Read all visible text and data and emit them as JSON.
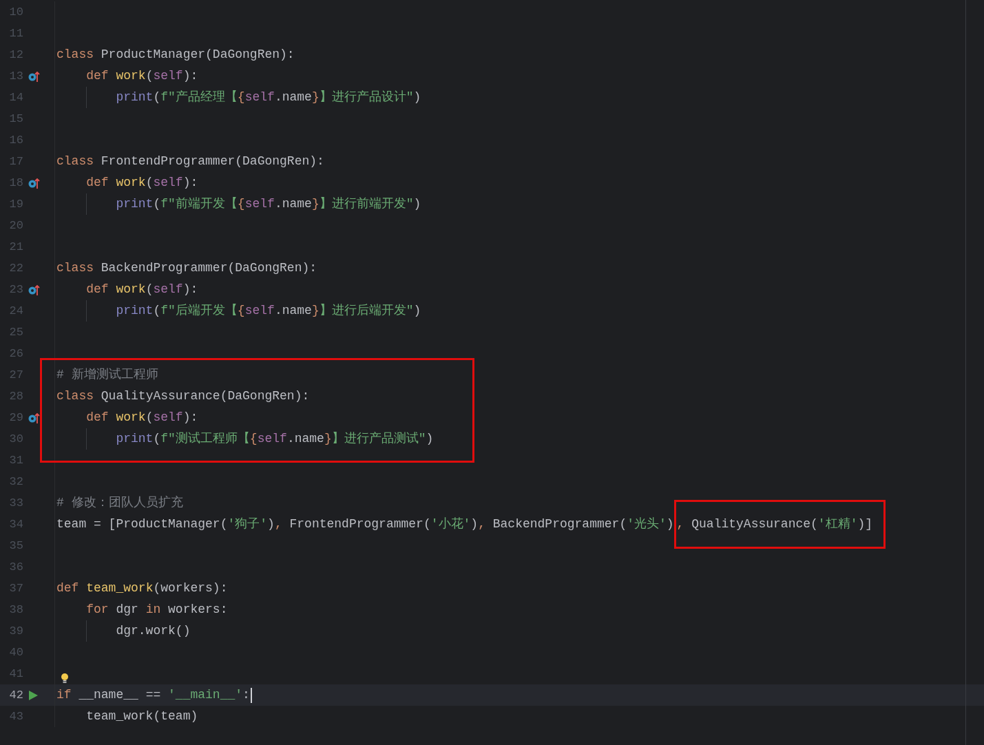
{
  "lines": [
    {
      "number": "10"
    },
    {
      "number": "11"
    },
    {
      "number": "12",
      "tokens": [
        {
          "kind": "kw",
          "text": "class"
        },
        {
          "kind": "plain",
          "text": " ProductManager(DaGongRen):"
        }
      ]
    },
    {
      "number": "13",
      "gutter_icon": {
        "kind": "override"
      },
      "tokens": [
        {
          "kind": "kw",
          "text": "    def "
        },
        {
          "kind": "fn",
          "text": "work"
        },
        {
          "kind": "plain",
          "text": "("
        },
        {
          "kind": "self",
          "text": "self"
        },
        {
          "kind": "plain",
          "text": "):"
        }
      ]
    },
    {
      "number": "14",
      "tokens": [
        {
          "kind": "builtin",
          "text": "        print"
        },
        {
          "kind": "plain",
          "text": "("
        },
        {
          "kind": "str",
          "text": "f\"产品经理【"
        },
        {
          "kind": "brace",
          "text": "{"
        },
        {
          "kind": "self",
          "text": "self"
        },
        {
          "kind": "plain",
          "text": ".name"
        },
        {
          "kind": "brace",
          "text": "}"
        },
        {
          "kind": "str",
          "text": "】进行产品设计\""
        },
        {
          "kind": "plain",
          "text": ")"
        }
      ]
    },
    {
      "number": "15"
    },
    {
      "number": "16"
    },
    {
      "number": "17",
      "tokens": [
        {
          "kind": "kw",
          "text": "class"
        },
        {
          "kind": "plain",
          "text": " FrontendProgrammer(DaGongRen):"
        }
      ]
    },
    {
      "number": "18",
      "gutter_icon": {
        "kind": "override"
      },
      "tokens": [
        {
          "kind": "kw",
          "text": "    def "
        },
        {
          "kind": "fn",
          "text": "work"
        },
        {
          "kind": "plain",
          "text": "("
        },
        {
          "kind": "self",
          "text": "self"
        },
        {
          "kind": "plain",
          "text": "):"
        }
      ]
    },
    {
      "number": "19",
      "tokens": [
        {
          "kind": "builtin",
          "text": "        print"
        },
        {
          "kind": "plain",
          "text": "("
        },
        {
          "kind": "str",
          "text": "f\"前端开发【"
        },
        {
          "kind": "brace",
          "text": "{"
        },
        {
          "kind": "self",
          "text": "self"
        },
        {
          "kind": "plain",
          "text": ".name"
        },
        {
          "kind": "brace",
          "text": "}"
        },
        {
          "kind": "str",
          "text": "】进行前端开发\""
        },
        {
          "kind": "plain",
          "text": ")"
        }
      ]
    },
    {
      "number": "20"
    },
    {
      "number": "21"
    },
    {
      "number": "22",
      "tokens": [
        {
          "kind": "kw",
          "text": "class"
        },
        {
          "kind": "plain",
          "text": " BackendProgrammer(DaGongRen):"
        }
      ]
    },
    {
      "number": "23",
      "gutter_icon": {
        "kind": "override"
      },
      "tokens": [
        {
          "kind": "kw",
          "text": "    def "
        },
        {
          "kind": "fn",
          "text": "work"
        },
        {
          "kind": "plain",
          "text": "("
        },
        {
          "kind": "self",
          "text": "self"
        },
        {
          "kind": "plain",
          "text": "):"
        }
      ]
    },
    {
      "number": "24",
      "tokens": [
        {
          "kind": "builtin",
          "text": "        print"
        },
        {
          "kind": "plain",
          "text": "("
        },
        {
          "kind": "str",
          "text": "f\"后端开发【"
        },
        {
          "kind": "brace",
          "text": "{"
        },
        {
          "kind": "self",
          "text": "self"
        },
        {
          "kind": "plain",
          "text": ".name"
        },
        {
          "kind": "brace",
          "text": "}"
        },
        {
          "kind": "str",
          "text": "】进行后端开发\""
        },
        {
          "kind": "plain",
          "text": ")"
        }
      ]
    },
    {
      "number": "25"
    },
    {
      "number": "26"
    },
    {
      "number": "27",
      "boxed": true,
      "tokens": [
        {
          "kind": "comment",
          "text": "# 新增测试工程师"
        }
      ]
    },
    {
      "number": "28",
      "boxed": true,
      "tokens": [
        {
          "kind": "kw",
          "text": "class"
        },
        {
          "kind": "plain",
          "text": " QualityAssurance(DaGongRen):"
        }
      ]
    },
    {
      "number": "29",
      "boxed": true,
      "gutter_icon": {
        "kind": "override"
      },
      "tokens": [
        {
          "kind": "kw",
          "text": "    def "
        },
        {
          "kind": "fn",
          "text": "work"
        },
        {
          "kind": "plain",
          "text": "("
        },
        {
          "kind": "self",
          "text": "self"
        },
        {
          "kind": "plain",
          "text": "):"
        }
      ]
    },
    {
      "number": "30",
      "boxed": true,
      "tokens": [
        {
          "kind": "builtin",
          "text": "        print"
        },
        {
          "kind": "plain",
          "text": "("
        },
        {
          "kind": "str",
          "text": "f\"测试工程师【"
        },
        {
          "kind": "brace",
          "text": "{"
        },
        {
          "kind": "self",
          "text": "self"
        },
        {
          "kind": "plain",
          "text": ".name"
        },
        {
          "kind": "brace",
          "text": "}"
        },
        {
          "kind": "str",
          "text": "】进行产品测试\""
        },
        {
          "kind": "plain",
          "text": ")"
        }
      ]
    },
    {
      "number": "31",
      "boxed": true
    },
    {
      "number": "32"
    },
    {
      "number": "33",
      "tokens": [
        {
          "kind": "comment",
          "text": "# 修改：团队人员扩充"
        }
      ]
    },
    {
      "number": "34",
      "tokens": [
        {
          "kind": "plain",
          "text": "team = [ProductManager("
        },
        {
          "kind": "str",
          "text": "'狗子'"
        },
        {
          "kind": "plain",
          "text": ")"
        },
        {
          "kind": "punct",
          "text": ", "
        },
        {
          "kind": "plain",
          "text": "FrontendProgrammer("
        },
        {
          "kind": "str",
          "text": "'小花'"
        },
        {
          "kind": "plain",
          "text": ")"
        },
        {
          "kind": "punct",
          "text": ", "
        },
        {
          "kind": "plain",
          "text": "BackendProgrammer("
        },
        {
          "kind": "str",
          "text": "'光头'"
        },
        {
          "kind": "plain",
          "text": ")"
        },
        {
          "kind": "punct",
          "text": ",",
          "boxed": true
        },
        {
          "kind": "plain",
          "text": " QualityAssurance(",
          "boxed": true
        },
        {
          "kind": "str",
          "text": "'杠精'",
          "boxed": true
        },
        {
          "kind": "plain",
          "text": ")]",
          "boxed": true
        }
      ]
    },
    {
      "number": "35"
    },
    {
      "number": "36"
    },
    {
      "number": "37",
      "tokens": [
        {
          "kind": "kw",
          "text": "def "
        },
        {
          "kind": "fn",
          "text": "team_work"
        },
        {
          "kind": "plain",
          "text": "(workers):"
        }
      ]
    },
    {
      "number": "38",
      "tokens": [
        {
          "kind": "kw",
          "text": "    for"
        },
        {
          "kind": "plain",
          "text": " dgr "
        },
        {
          "kind": "kw",
          "text": "in"
        },
        {
          "kind": "plain",
          "text": " workers:"
        }
      ]
    },
    {
      "number": "39",
      "tokens": [
        {
          "kind": "plain",
          "text": "        dgr.work()"
        }
      ]
    },
    {
      "number": "40"
    },
    {
      "number": "41",
      "bulb": true
    },
    {
      "number": "42",
      "gutter_icon": {
        "kind": "run"
      },
      "current": true,
      "caret": true,
      "tokens": [
        {
          "kind": "kw",
          "text": "if"
        },
        {
          "kind": "plain",
          "text": " __name__ == "
        },
        {
          "kind": "str",
          "text": "'__main__'"
        },
        {
          "kind": "plain",
          "text": ":"
        }
      ]
    },
    {
      "number": "43",
      "tokens": [
        {
          "kind": "plain",
          "text": "    team_work(team)"
        }
      ]
    }
  ]
}
